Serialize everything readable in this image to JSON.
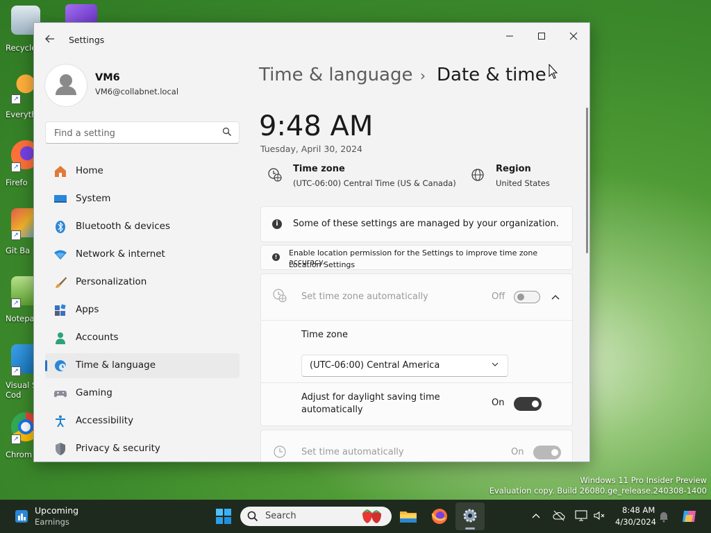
{
  "desktop": {
    "icons": [
      {
        "label": "Recycle",
        "name": "recycle-bin-icon"
      },
      {
        "label": "Everyth",
        "name": "everything-icon"
      },
      {
        "label": "Firefo",
        "name": "firefox-desktop-icon"
      },
      {
        "label": "Git Ba",
        "name": "git-bash-icon"
      },
      {
        "label": "Notepa",
        "name": "notepad-icon"
      },
      {
        "label": "Visual St\nCod",
        "name": "vscode-icon"
      },
      {
        "label": "Chrom",
        "name": "chrome-icon"
      }
    ],
    "watermark_line1": "Windows 11 Pro Insider Preview",
    "watermark_line2": "Evaluation copy. Build 26080.ge_release.240308-1400"
  },
  "window": {
    "title": "Settings",
    "profile": {
      "name": "VM6",
      "email": "VM6@collabnet.local"
    },
    "search_placeholder": "Find a setting",
    "nav": [
      {
        "label": "Home"
      },
      {
        "label": "System"
      },
      {
        "label": "Bluetooth & devices"
      },
      {
        "label": "Network & internet"
      },
      {
        "label": "Personalization"
      },
      {
        "label": "Apps"
      },
      {
        "label": "Accounts"
      },
      {
        "label": "Time & language",
        "selected": true
      },
      {
        "label": "Gaming"
      },
      {
        "label": "Accessibility"
      },
      {
        "label": "Privacy & security"
      }
    ]
  },
  "content": {
    "breadcrumb_parent": "Time & language",
    "breadcrumb_sep": "›",
    "breadcrumb_current": "Date & time",
    "time": "9:48 AM",
    "date": "Tuesday, April 30, 2024",
    "timezone_title": "Time zone",
    "timezone_value": "(UTC-06:00) Central Time (US & Canada)",
    "region_title": "Region",
    "region_value": "United States",
    "managed_notice": "Some of these settings are managed by your organization.",
    "location_notice": "Enable location permission for the Settings to improve time zone accuracy.",
    "location_link": "Location Settings",
    "auto_tz": {
      "label": "Set time zone automatically",
      "state": "Off"
    },
    "tz_section_label": "Time zone",
    "tz_dropdown_value": "(UTC-06:00) Central America",
    "dst": {
      "label_line1": "Adjust for daylight saving time",
      "label_line2": "automatically",
      "state": "On"
    },
    "auto_time": {
      "label": "Set time automatically",
      "state": "On"
    }
  },
  "taskbar": {
    "widget_title": "Upcoming",
    "widget_sub": "Earnings",
    "search_label": "Search",
    "clock_time": "8:48 AM",
    "clock_date": "4/30/2024",
    "accent": "#2a6fc9"
  }
}
